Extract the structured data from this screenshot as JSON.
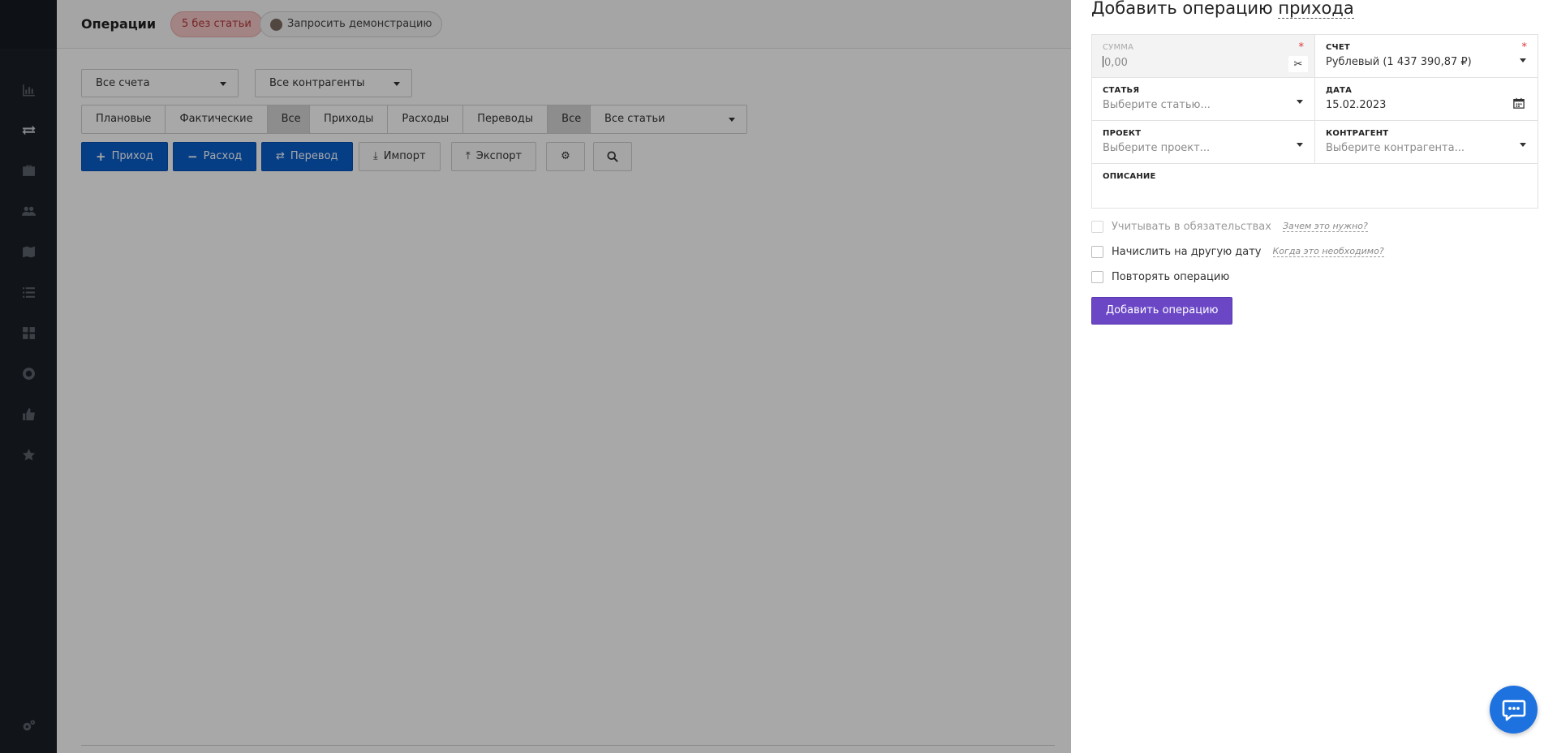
{
  "header": {
    "title": "Операции",
    "no_category_badge": "5 без статьи",
    "demo_button": "Запросить демонстрацию"
  },
  "filters": {
    "accounts": "Все счета",
    "counterparties": "Все контрагенты",
    "categories": "Все статьи"
  },
  "status_tabs": [
    "Плановые",
    "Фактические",
    "Все"
  ],
  "status_active": "Все",
  "type_tabs": [
    "Приходы",
    "Расходы",
    "Переводы",
    "Все"
  ],
  "type_active": "Все",
  "actions": {
    "income": "Приход",
    "expense": "Расход",
    "transfer": "Перевод",
    "import": "Импорт",
    "export": "Экспорт"
  },
  "panel": {
    "title_prefix": "Добавить операцию",
    "title_type": "прихода",
    "fields": {
      "amount_label": "Сумма",
      "amount_placeholder": "0,00",
      "account_label": "Счет",
      "account_value": "Рублевый (1 437 390,87 ₽)",
      "category_label": "Статья",
      "category_placeholder": "Выберите статью...",
      "date_label": "Дата",
      "date_value": "15.02.2023",
      "project_label": "Проект",
      "project_placeholder": "Выберите проект...",
      "counterparty_label": "Контрагент",
      "counterparty_placeholder": "Выберите контрагента...",
      "description_label": "Описание"
    },
    "required_mark": "*",
    "options": {
      "obligations": "Учитывать в обязательствах",
      "obligations_help": "Зачем это нужно?",
      "other_date": "Начислить на другую дату",
      "other_date_help": "Когда это необходимо?",
      "repeat": "Повторять операцию"
    },
    "submit": "Добавить операцию"
  },
  "colors": {
    "sidebar_bg": "#1b1f27",
    "primary_blue": "#0a5fcc",
    "submit_purple": "#6b47c6",
    "chat_blue": "#1d72e0",
    "badge_red_text": "#b3393b"
  },
  "icons": {
    "sidebar": [
      "chart-icon",
      "transfer-icon",
      "briefcase-icon",
      "users-icon",
      "map-icon",
      "list-icon",
      "grid-icon",
      "lifebuoy-icon",
      "thumbs-up-icon",
      "star-icon",
      "settings-icon"
    ]
  }
}
